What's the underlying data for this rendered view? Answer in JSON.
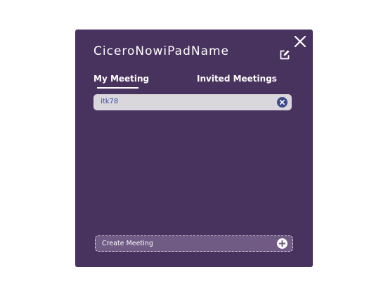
{
  "colors": {
    "panel_background": "#48325e",
    "meeting_item_background": "#d9d6dc",
    "meeting_text": "#3a4ba0",
    "create_button_background": "#6f5b84"
  },
  "dialog": {
    "title": "CiceroNowiPadName",
    "close_icon": "close-icon",
    "edit_icon": "edit-icon"
  },
  "tabs": [
    {
      "label": "My Meeting",
      "active": true
    },
    {
      "label": "Invited Meetings",
      "active": false
    }
  ],
  "meetings": [
    {
      "name": "itk78",
      "remove_icon": "remove-icon"
    }
  ],
  "create": {
    "label": "Create Meeting",
    "icon": "plus-circle-icon"
  }
}
